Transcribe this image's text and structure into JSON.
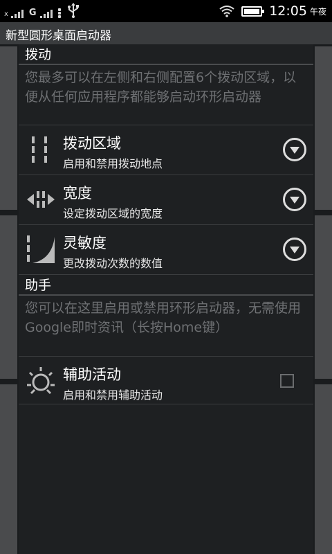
{
  "status_bar": {
    "signal1_label": "x",
    "signal2_label": "G",
    "time": "12:05",
    "ampm": "午夜",
    "icons": [
      "signal-icon",
      "signal-icon",
      "menu-dots-icon",
      "usb-icon",
      "wifi-icon",
      "battery-icon"
    ]
  },
  "app_title": "新型圆形桌面启动器",
  "categories": [
    {
      "title": "拨动",
      "description": "您最多可以在左侧和右侧配置6个拨动区域，以便从任何应用程序都能够启动环形启动器",
      "items": [
        {
          "title": "拨动区域",
          "summary": "启用和禁用拨动地点",
          "icon": "swipe-zones-icon",
          "control": "dropdown"
        },
        {
          "title": "宽度",
          "summary": "设定拨动区域的宽度",
          "icon": "width-icon",
          "control": "dropdown"
        },
        {
          "title": "灵敏度",
          "summary": "更改拨动次数的数值",
          "icon": "sensitivity-icon",
          "control": "dropdown"
        }
      ]
    },
    {
      "title": "助手",
      "description": "您可以在这里启用或禁用环形启动器，无需使用Google即时资讯（长按Home键）",
      "items": [
        {
          "title": "辅助活动",
          "summary": "启用和禁用辅助活动",
          "icon": "assist-activity-icon",
          "control": "checkbox",
          "checked": false
        }
      ]
    }
  ],
  "colors": {
    "background": "#1a1c1e",
    "column": "#1e2022",
    "divider": "#4a4c4e",
    "description_text": "#6e7073",
    "titlebar": "#3a3c3e"
  }
}
